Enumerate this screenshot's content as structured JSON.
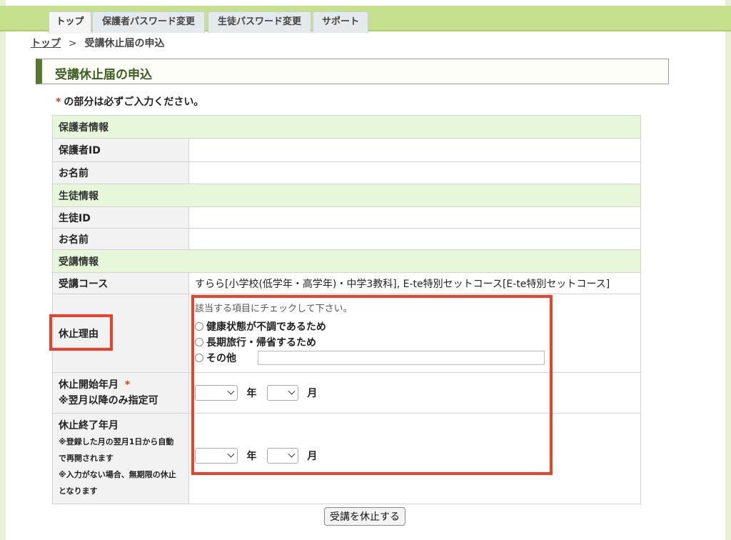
{
  "nav": {
    "tabs": [
      {
        "label": "トップ",
        "active": true
      },
      {
        "label": "保護者パスワード変更",
        "active": false
      },
      {
        "label": "生徒パスワード変更",
        "active": false
      },
      {
        "label": "サポート",
        "active": false
      }
    ]
  },
  "breadcrumb": {
    "home": "トップ",
    "separator": ">",
    "current": "受講休止届の申込"
  },
  "page": {
    "title": "受講休止届の申込",
    "required_star": "*",
    "required_note": "の部分は必ずご入力ください。"
  },
  "form": {
    "guardian_section": "保護者情報",
    "guardian_id_label": "保護者ID",
    "guardian_name_label": "お名前",
    "student_section": "生徒情報",
    "student_id_label": "生徒ID",
    "student_name_label": "お名前",
    "course_section": "受講情報",
    "course_label": "受講コース",
    "course_value": "すらら[小学校(低学年・高学年)・中学3教科], E-te特別セットコース[E-te特別セットコース]",
    "reason_label": "休止理由",
    "reason_instruction": "該当する項目にチェックして下さい。",
    "reason_options": [
      "健康状態が不調であるため",
      "長期旅行・帰省するため",
      "その他"
    ],
    "start_label": "休止開始年月",
    "start_star": "*",
    "start_note": "※翌月以降のみ指定可",
    "end_label": "休止終了年月",
    "end_note_1": "※登録した月の翌月1日から自動",
    "end_note_2": "で再開されます",
    "end_note_3": "※入力がない場合、無期限の休止",
    "end_note_4": "となります",
    "year_unit": "年",
    "month_unit": "月"
  },
  "submit_label": "受講を休止する",
  "colors": {
    "nav": "#c5e18e",
    "accent": "#557a2f",
    "section_bg": "#e6f8d9",
    "highlight": "#e8412c"
  }
}
